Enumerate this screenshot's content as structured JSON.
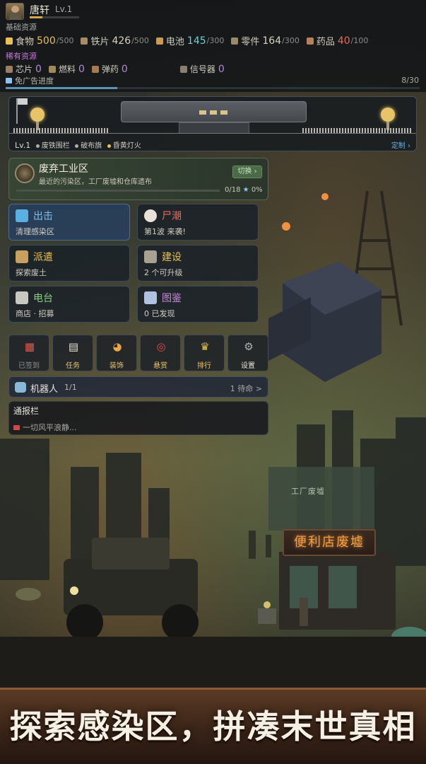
{
  "player": {
    "name": "唐轩",
    "level": "Lv.1",
    "xp_fraction": 0.25
  },
  "basic_resources": {
    "label": "基础资源",
    "items": [
      {
        "name": "食物",
        "value": "500",
        "max": "/500",
        "color": "#e8c056"
      },
      {
        "name": "铁片",
        "value": "426",
        "max": "/500",
        "color": "#d7d2c0"
      },
      {
        "name": "电池",
        "value": "145",
        "max": "/300",
        "color": "#6cd0d8"
      },
      {
        "name": "零件",
        "value": "164",
        "max": "/300",
        "color": "#d7d2c0"
      },
      {
        "name": "药品",
        "value": "40",
        "max": "/100",
        "color": "#e86a5e"
      }
    ]
  },
  "rare_resources": {
    "label": "稀有资源",
    "items": [
      {
        "name": "芯片",
        "value": "0"
      },
      {
        "name": "燃料",
        "value": "0"
      },
      {
        "name": "弹药",
        "value": "0"
      },
      {
        "name": "信号器",
        "value": "0"
      }
    ]
  },
  "ad_progress": {
    "label": "免广告进度",
    "count": "8/30",
    "fraction": 0.27
  },
  "base": {
    "level": "Lv.1",
    "chips": [
      "废铁围栏",
      "破布旗",
      "昏黄灯火"
    ],
    "customize": "定制 ›"
  },
  "zone": {
    "title": "废弃工业区",
    "description": "最近的污染区，工厂废墟和仓库遗布",
    "switch_label": "切换 ›",
    "progress": "0/18",
    "percent": "0%",
    "fraction": 0
  },
  "tiles": [
    {
      "title": "出击",
      "subtitle": "清理感染区",
      "icon": "map-icon"
    },
    {
      "title": "尸潮",
      "subtitle": "第1波 来袭!",
      "icon": "skull-icon"
    },
    {
      "title": "派遣",
      "subtitle": "探索废土",
      "icon": "dispatch-icon"
    },
    {
      "title": "建设",
      "subtitle": "2 个可升级",
      "icon": "hammer-icon"
    },
    {
      "title": "电台",
      "subtitle": "商店 · 招募",
      "icon": "radio-icon"
    },
    {
      "title": "图鉴",
      "subtitle": "0 已发现",
      "icon": "book-icon"
    }
  ],
  "shortcuts": [
    {
      "label": "已签到",
      "icon": "calendar-icon",
      "glyph": "▦"
    },
    {
      "label": "任务",
      "icon": "clipboard-icon",
      "glyph": "▤"
    },
    {
      "label": "装饰",
      "icon": "palette-icon",
      "glyph": "◕"
    },
    {
      "label": "悬赏",
      "icon": "target-icon",
      "glyph": "◎"
    },
    {
      "label": "排行",
      "icon": "trophy-icon",
      "glyph": "♛"
    },
    {
      "label": "设置",
      "icon": "gear-icon",
      "glyph": "⚙"
    }
  ],
  "robot": {
    "title": "机器人",
    "count": "1/1",
    "standby": "1 待命 >"
  },
  "notice": {
    "title": "通报栏",
    "message": "一切风平浪静..."
  },
  "scene_labels": {
    "factory": "工厂废墟",
    "store": "便利店废墟"
  },
  "banner": {
    "text": "探索感染区，拼凑末世真相"
  }
}
